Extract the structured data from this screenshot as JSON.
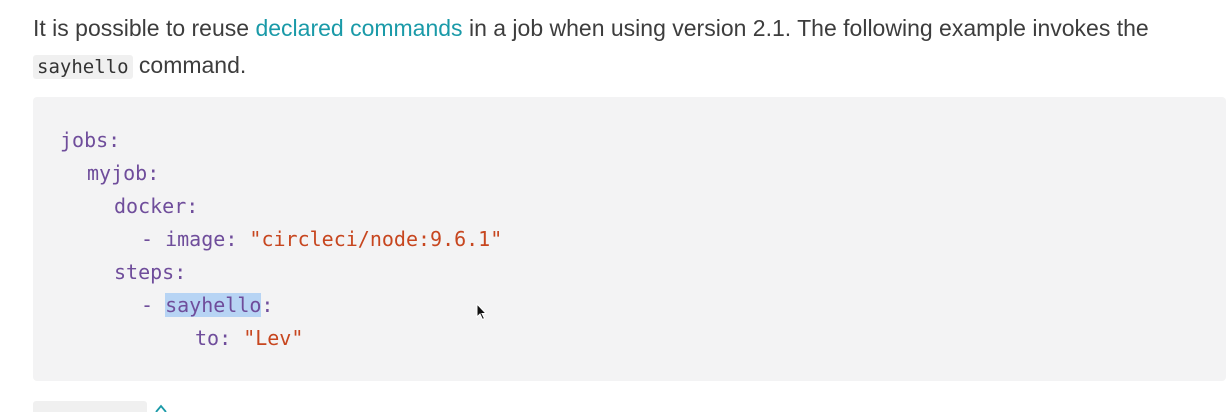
{
  "paragraph": {
    "text_before": "It is possible to reuse ",
    "link_text": "declared commands",
    "text_after": " in a job when using version 2.1. The following example invokes the",
    "inline_code": "sayhello",
    "text_end": " command."
  },
  "code": {
    "lines": [
      {
        "key": "jobs",
        "punct": ":"
      },
      {
        "key": "myjob",
        "punct": ":"
      },
      {
        "key": "docker",
        "punct": ":"
      },
      {
        "dash": "- ",
        "key": "image",
        "punct": ": ",
        "value": "\"circleci/node:9.6.1\""
      },
      {
        "key": "steps",
        "punct": ":"
      },
      {
        "dash": "- ",
        "key": "sayhello",
        "punct": ":"
      },
      {
        "key": "to",
        "punct": ": ",
        "value": "\"Lev\""
      }
    ]
  },
  "colors": {
    "link": "#1a9aa8",
    "code_key": "#6f4d9b",
    "code_string": "#c7461f",
    "code_background": "#f3f3f4",
    "selection": "#b7d4f4"
  },
  "icons": {
    "cursor": "mouse-pointer-icon",
    "bottom": "link-anchor-icon"
  }
}
